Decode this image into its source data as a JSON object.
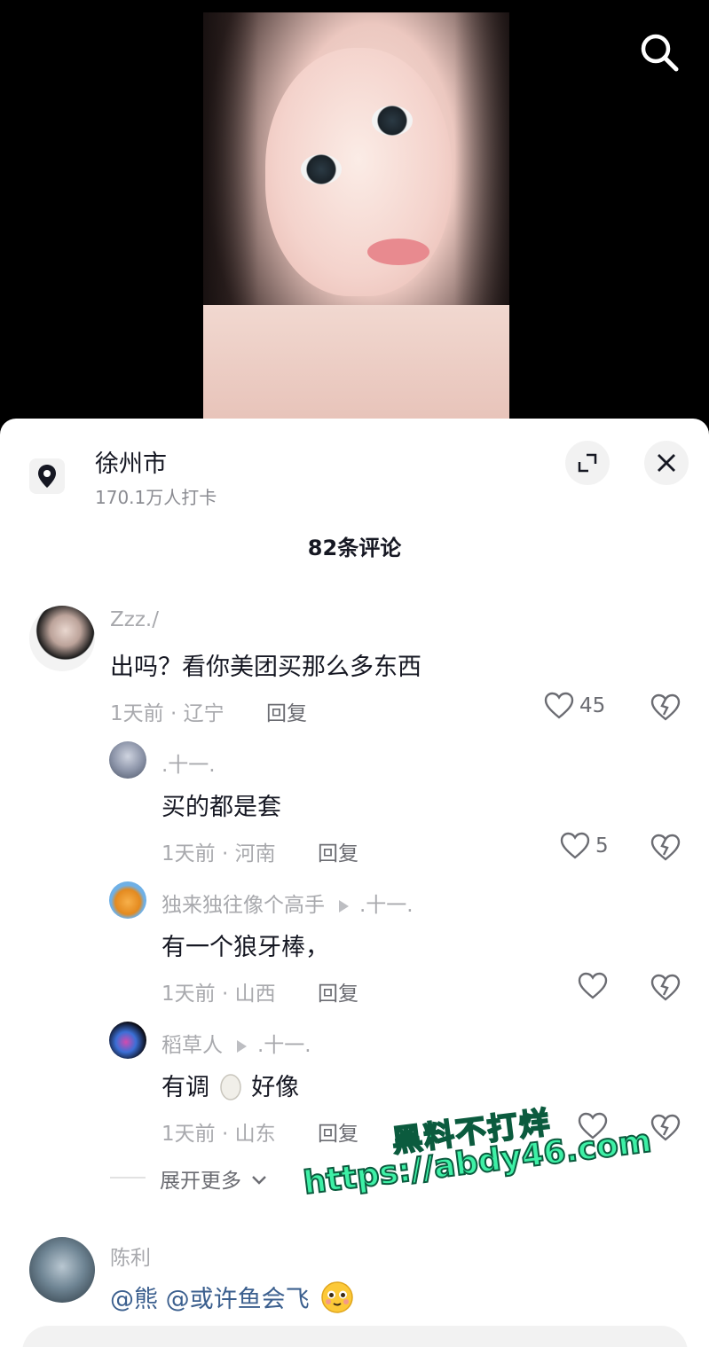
{
  "location": {
    "title": "徐州市",
    "subtitle": "170.1万人打卡"
  },
  "comments_header": "82条评论",
  "comments": [
    {
      "user": "Zzz./",
      "text": "出吗？看你美团买那么多东西",
      "time_loc": "1天前 · 辽宁",
      "reply": "回复",
      "likes": "45"
    }
  ],
  "replies": [
    {
      "user": ".十一.",
      "text": "买的都是套",
      "time_loc": "1天前 · 河南",
      "reply": "回复",
      "likes": "5"
    },
    {
      "user": "独来独往像个高手",
      "reply_to": ".十一.",
      "text": "有一个狼牙棒，",
      "time_loc": "1天前 · 山西",
      "reply": "回复",
      "likes": ""
    },
    {
      "user": "稻草人",
      "reply_to": ".十一.",
      "text_a": "有调",
      "text_b": "好像",
      "time_loc": "1天前 · 山东",
      "reply": "回复",
      "likes": ""
    }
  ],
  "expand_more": "展开更多",
  "next_comment": {
    "user": "陈利",
    "mention1": "@熊",
    "mention2": "@或许鱼会飞"
  },
  "watermark": {
    "line1": "黑料不打烊",
    "line2": "https://abdy46.com"
  },
  "icons": {
    "search": "search-icon",
    "location": "location-pin-icon",
    "expand": "expand-icon",
    "close": "close-icon",
    "like": "heart-icon",
    "dislike": "broken-heart-icon"
  },
  "colors": {
    "mention": "#3b5f8e",
    "watermark": "#3ef0a6"
  }
}
